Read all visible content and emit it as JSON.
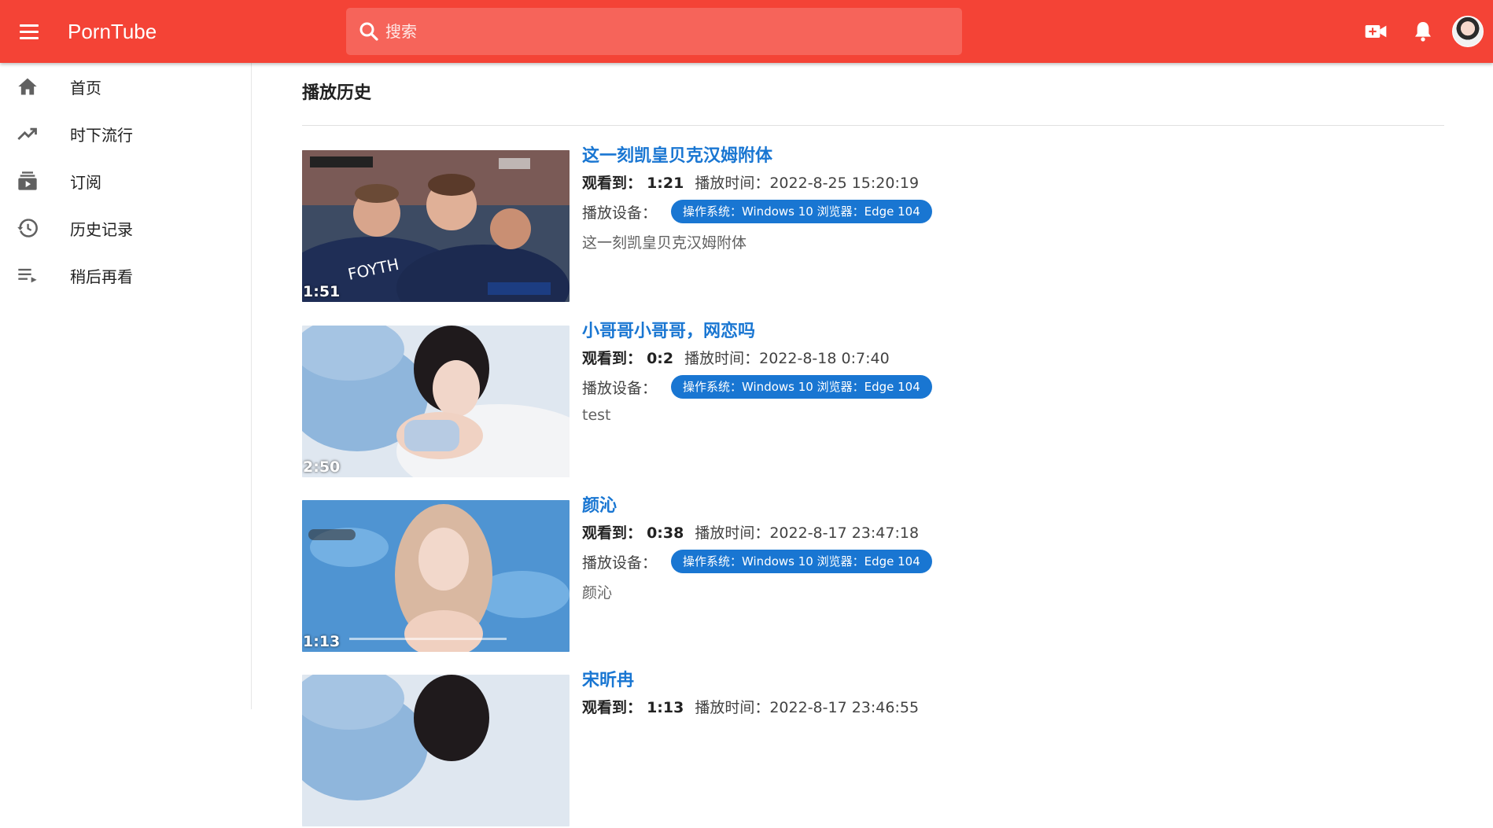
{
  "app": {
    "brand": "PornTube",
    "search_placeholder": "搜索"
  },
  "sidebar": {
    "items": [
      {
        "label": "首页",
        "icon": "home-icon"
      },
      {
        "label": "时下流行",
        "icon": "trending-icon"
      },
      {
        "label": "订阅",
        "icon": "subscriptions-icon"
      },
      {
        "label": "历史记录",
        "icon": "history-icon"
      },
      {
        "label": "稍后再看",
        "icon": "watch-later-icon"
      }
    ]
  },
  "main": {
    "title": "播放历史",
    "labels": {
      "watched_to": "观看到：",
      "played_at": "播放时间：",
      "device": "播放设备："
    },
    "items": [
      {
        "title": "这一刻凯皇贝克汉姆附体",
        "duration": "1:51",
        "watched": "1:21",
        "played_time": "2022-8-25 15:20:19",
        "device": "操作系统：Windows 10 浏览器：Edge 104",
        "description": "这一刻凯皇贝克汉姆附体"
      },
      {
        "title": "小哥哥小哥哥，网恋吗",
        "duration": "2:50",
        "watched": "0:2",
        "played_time": "2022-8-18 0:7:40",
        "device": "操作系统：Windows 10 浏览器：Edge 104",
        "description": "test"
      },
      {
        "title": "颜沁",
        "duration": "1:13",
        "watched": "0:38",
        "played_time": "2022-8-17 23:47:18",
        "device": "操作系统：Windows 10 浏览器：Edge 104",
        "description": "颜沁"
      },
      {
        "title": "宋昕冉",
        "watched": "1:13",
        "played_time": "2022-8-17 23:46:55"
      }
    ]
  },
  "colors": {
    "appbar": "#f44336",
    "link": "#1976d2",
    "chip": "#1976d2"
  }
}
